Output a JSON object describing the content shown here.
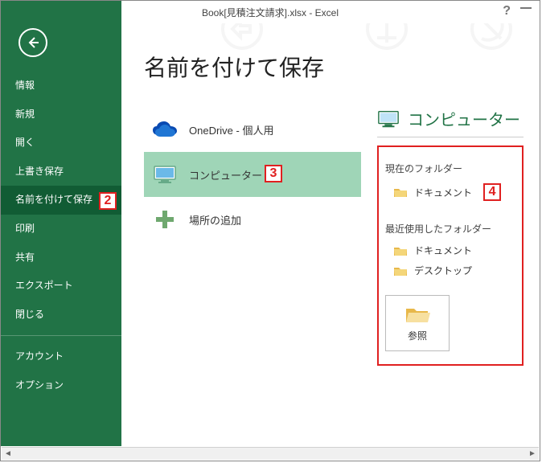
{
  "window": {
    "title": "Book[見積注文請求].xlsx - Excel"
  },
  "sidebar": {
    "items": [
      {
        "label": "情報"
      },
      {
        "label": "新規"
      },
      {
        "label": "開く"
      },
      {
        "label": "上書き保存"
      },
      {
        "label": "名前を付けて保存",
        "selected": true
      },
      {
        "label": "印刷"
      },
      {
        "label": "共有"
      },
      {
        "label": "エクスポート"
      },
      {
        "label": "閉じる"
      },
      {
        "label": "アカウント"
      },
      {
        "label": "オプション"
      }
    ]
  },
  "page": {
    "title": "名前を付けて保存"
  },
  "places": [
    {
      "label": "OneDrive - 個人用",
      "icon": "onedrive"
    },
    {
      "label": "コンピューター",
      "icon": "computer",
      "selected": true
    },
    {
      "label": "場所の追加",
      "icon": "add"
    }
  ],
  "panel": {
    "title": "コンピューター",
    "current_folder_label": "現在のフォルダー",
    "current_folder": "ドキュメント",
    "recent_label": "最近使用したフォルダー",
    "recent": [
      "ドキュメント",
      "デスクトップ"
    ],
    "browse_label": "参照"
  },
  "callouts": {
    "c2": "2",
    "c3": "3",
    "c4": "4"
  }
}
